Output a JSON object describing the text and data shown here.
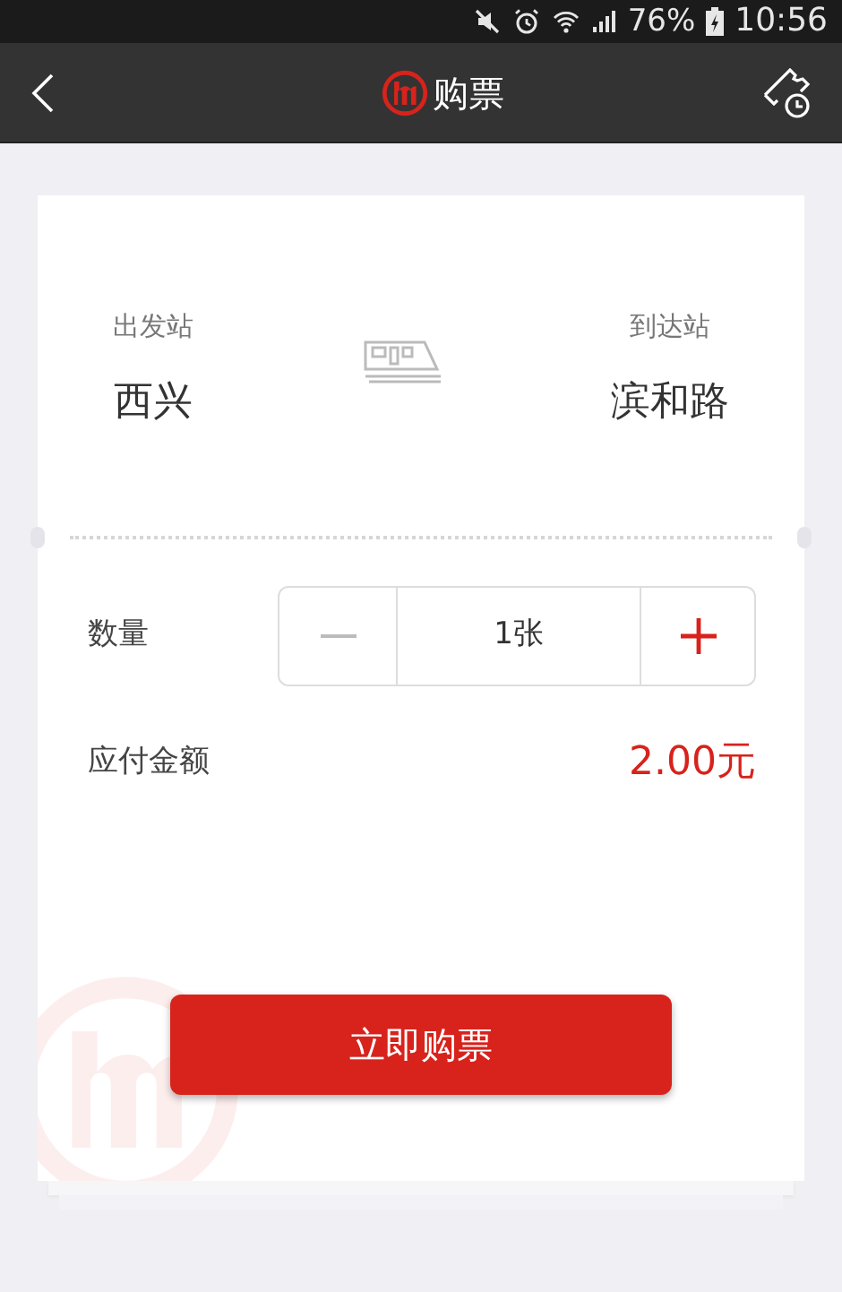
{
  "status_bar": {
    "battery": "76%",
    "time": "10:56"
  },
  "header": {
    "title": "购票"
  },
  "route": {
    "from": {
      "label": "出发站",
      "station": "西兴"
    },
    "to": {
      "label": "到达站",
      "station": "滨和路"
    }
  },
  "quantity": {
    "label": "数量",
    "value": "1张",
    "decrement_disabled": true,
    "increment_disabled": false
  },
  "amount": {
    "label": "应付金额",
    "value": "2.00元"
  },
  "buy_button": "立即购票"
}
